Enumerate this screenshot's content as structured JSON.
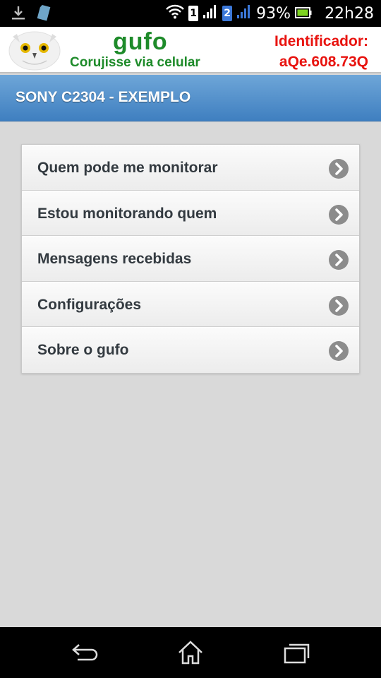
{
  "status_bar": {
    "battery_percent": "93%",
    "time": "22h28",
    "sim1": "1",
    "sim2": "2",
    "icons": [
      "download-icon",
      "sd-card-icon",
      "wifi-icon",
      "signal-icon",
      "battery-icon"
    ]
  },
  "banner": {
    "app_name": "gufo",
    "tagline": "Corujisse via celular",
    "identifier_label": "Identificador:",
    "identifier_value": "aQe.608.73Q",
    "brand_color": "#1e8b2a",
    "identifier_color": "#e8130f"
  },
  "title_bar": {
    "title": "SONY C2304 - EXEMPLO",
    "color": "#4a88c8"
  },
  "menu": {
    "items": [
      {
        "label": "Quem pode me monitorar",
        "icon": "chevron-right-icon"
      },
      {
        "label": "Estou monitorando quem",
        "icon": "chevron-right-icon"
      },
      {
        "label": "Mensagens recebidas",
        "icon": "chevron-right-icon"
      },
      {
        "label": "Configurações",
        "icon": "chevron-right-icon"
      },
      {
        "label": "Sobre o gufo",
        "icon": "chevron-right-icon"
      }
    ]
  },
  "nav_bar": {
    "buttons": [
      "back-icon",
      "home-icon",
      "recent-apps-icon"
    ]
  }
}
